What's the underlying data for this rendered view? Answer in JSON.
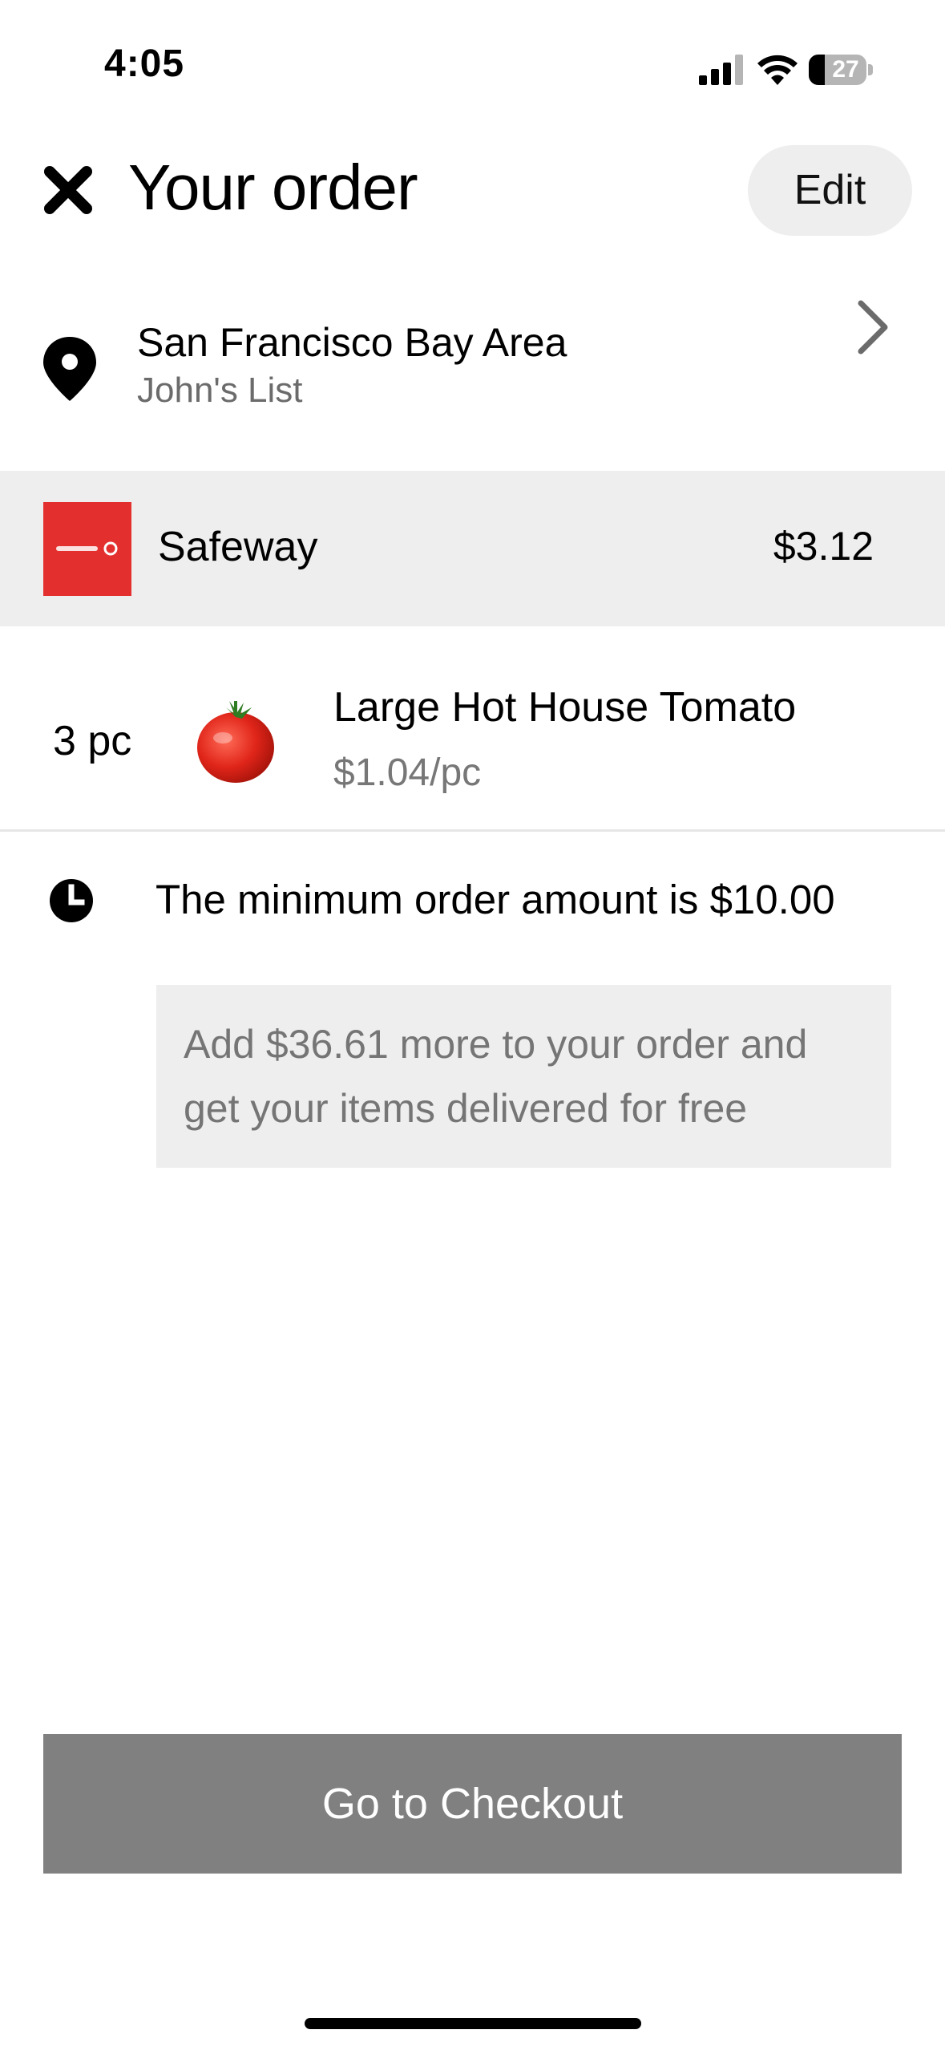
{
  "status_bar": {
    "time": "4:05",
    "battery": "27"
  },
  "header": {
    "title": "Your order",
    "edit_label": "Edit",
    "close_icon": "close-icon"
  },
  "location": {
    "title": "San Francisco Bay Area",
    "subtitle": "John's List",
    "icon": "map-pin-icon"
  },
  "store": {
    "name": "Safeway",
    "total": "$3.12",
    "brand_color": "#e3302f"
  },
  "items": [
    {
      "quantity": "3 pc",
      "name": "Large Hot House Tomato",
      "unit_price": "$1.04/pc"
    }
  ],
  "minimum_order": {
    "message": "The minimum order amount is $10.00",
    "promo": "Add $36.61 more to your order and get your items delivered for free"
  },
  "checkout": {
    "label": "Go to Checkout"
  }
}
